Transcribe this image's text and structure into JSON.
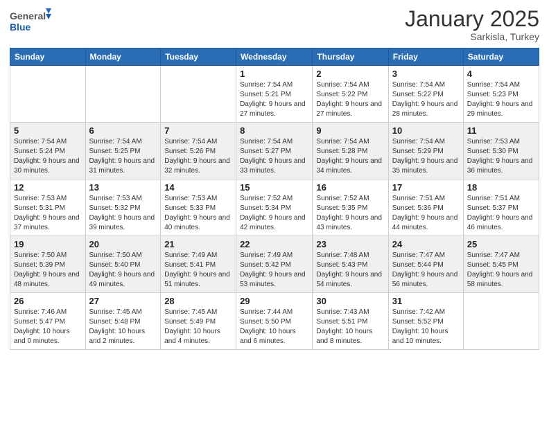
{
  "header": {
    "logo_general": "General",
    "logo_blue": "Blue",
    "month_year": "January 2025",
    "location": "Sarkisla, Turkey"
  },
  "days_of_week": [
    "Sunday",
    "Monday",
    "Tuesday",
    "Wednesday",
    "Thursday",
    "Friday",
    "Saturday"
  ],
  "weeks": [
    [
      {
        "day": "",
        "info": ""
      },
      {
        "day": "",
        "info": ""
      },
      {
        "day": "",
        "info": ""
      },
      {
        "day": "1",
        "info": "Sunrise: 7:54 AM\nSunset: 5:21 PM\nDaylight: 9 hours and 27 minutes."
      },
      {
        "day": "2",
        "info": "Sunrise: 7:54 AM\nSunset: 5:22 PM\nDaylight: 9 hours and 27 minutes."
      },
      {
        "day": "3",
        "info": "Sunrise: 7:54 AM\nSunset: 5:22 PM\nDaylight: 9 hours and 28 minutes."
      },
      {
        "day": "4",
        "info": "Sunrise: 7:54 AM\nSunset: 5:23 PM\nDaylight: 9 hours and 29 minutes."
      }
    ],
    [
      {
        "day": "5",
        "info": "Sunrise: 7:54 AM\nSunset: 5:24 PM\nDaylight: 9 hours and 30 minutes."
      },
      {
        "day": "6",
        "info": "Sunrise: 7:54 AM\nSunset: 5:25 PM\nDaylight: 9 hours and 31 minutes."
      },
      {
        "day": "7",
        "info": "Sunrise: 7:54 AM\nSunset: 5:26 PM\nDaylight: 9 hours and 32 minutes."
      },
      {
        "day": "8",
        "info": "Sunrise: 7:54 AM\nSunset: 5:27 PM\nDaylight: 9 hours and 33 minutes."
      },
      {
        "day": "9",
        "info": "Sunrise: 7:54 AM\nSunset: 5:28 PM\nDaylight: 9 hours and 34 minutes."
      },
      {
        "day": "10",
        "info": "Sunrise: 7:54 AM\nSunset: 5:29 PM\nDaylight: 9 hours and 35 minutes."
      },
      {
        "day": "11",
        "info": "Sunrise: 7:53 AM\nSunset: 5:30 PM\nDaylight: 9 hours and 36 minutes."
      }
    ],
    [
      {
        "day": "12",
        "info": "Sunrise: 7:53 AM\nSunset: 5:31 PM\nDaylight: 9 hours and 37 minutes."
      },
      {
        "day": "13",
        "info": "Sunrise: 7:53 AM\nSunset: 5:32 PM\nDaylight: 9 hours and 39 minutes."
      },
      {
        "day": "14",
        "info": "Sunrise: 7:53 AM\nSunset: 5:33 PM\nDaylight: 9 hours and 40 minutes."
      },
      {
        "day": "15",
        "info": "Sunrise: 7:52 AM\nSunset: 5:34 PM\nDaylight: 9 hours and 42 minutes."
      },
      {
        "day": "16",
        "info": "Sunrise: 7:52 AM\nSunset: 5:35 PM\nDaylight: 9 hours and 43 minutes."
      },
      {
        "day": "17",
        "info": "Sunrise: 7:51 AM\nSunset: 5:36 PM\nDaylight: 9 hours and 44 minutes."
      },
      {
        "day": "18",
        "info": "Sunrise: 7:51 AM\nSunset: 5:37 PM\nDaylight: 9 hours and 46 minutes."
      }
    ],
    [
      {
        "day": "19",
        "info": "Sunrise: 7:50 AM\nSunset: 5:39 PM\nDaylight: 9 hours and 48 minutes."
      },
      {
        "day": "20",
        "info": "Sunrise: 7:50 AM\nSunset: 5:40 PM\nDaylight: 9 hours and 49 minutes."
      },
      {
        "day": "21",
        "info": "Sunrise: 7:49 AM\nSunset: 5:41 PM\nDaylight: 9 hours and 51 minutes."
      },
      {
        "day": "22",
        "info": "Sunrise: 7:49 AM\nSunset: 5:42 PM\nDaylight: 9 hours and 53 minutes."
      },
      {
        "day": "23",
        "info": "Sunrise: 7:48 AM\nSunset: 5:43 PM\nDaylight: 9 hours and 54 minutes."
      },
      {
        "day": "24",
        "info": "Sunrise: 7:47 AM\nSunset: 5:44 PM\nDaylight: 9 hours and 56 minutes."
      },
      {
        "day": "25",
        "info": "Sunrise: 7:47 AM\nSunset: 5:45 PM\nDaylight: 9 hours and 58 minutes."
      }
    ],
    [
      {
        "day": "26",
        "info": "Sunrise: 7:46 AM\nSunset: 5:47 PM\nDaylight: 10 hours and 0 minutes."
      },
      {
        "day": "27",
        "info": "Sunrise: 7:45 AM\nSunset: 5:48 PM\nDaylight: 10 hours and 2 minutes."
      },
      {
        "day": "28",
        "info": "Sunrise: 7:45 AM\nSunset: 5:49 PM\nDaylight: 10 hours and 4 minutes."
      },
      {
        "day": "29",
        "info": "Sunrise: 7:44 AM\nSunset: 5:50 PM\nDaylight: 10 hours and 6 minutes."
      },
      {
        "day": "30",
        "info": "Sunrise: 7:43 AM\nSunset: 5:51 PM\nDaylight: 10 hours and 8 minutes."
      },
      {
        "day": "31",
        "info": "Sunrise: 7:42 AM\nSunset: 5:52 PM\nDaylight: 10 hours and 10 minutes."
      },
      {
        "day": "",
        "info": ""
      }
    ]
  ]
}
